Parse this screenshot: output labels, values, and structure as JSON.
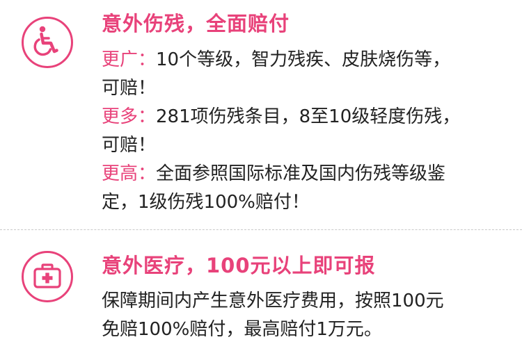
{
  "colors": {
    "accent": "#e8427a",
    "text": "#222222",
    "divider": "#c8c8c8"
  },
  "disability": {
    "icon": "wheelchair-icon",
    "title": "意外伤残，全面赔付",
    "items": [
      {
        "label": "更广：",
        "line1": "10个等级，智力残疾、皮肤烧伤等，",
        "line2": "可赔！"
      },
      {
        "label": "更多：",
        "line1": "281项伤残条目，8至10级轻度伤残，",
        "line2": "可赔！"
      },
      {
        "label": "更高：",
        "line1": "全面参照国际标准及国内伤残等级鉴",
        "line2": "定，1级伤残100%赔付！"
      }
    ]
  },
  "medical": {
    "icon": "first-aid-kit-icon",
    "title": "意外医疗，100元以上即可报",
    "line1": "保障期间内产生意外医疗费用，按照100元",
    "line2": "免赔100%赔付，最高赔付1万元。"
  }
}
